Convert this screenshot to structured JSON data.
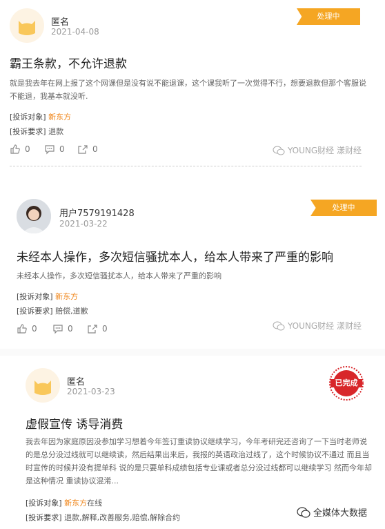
{
  "cards": [
    {
      "user": "匿名",
      "date": "2021-04-08",
      "status": "处理中",
      "title": "霸王条款，不允许退款",
      "body": "就是我去年在网上报了这个网课但是没有说不能退课，这个课我听了一次觉得不行，想要退款但那个客服说不能退，我基本就没听.",
      "target_label": "[投诉对象]",
      "target": "新东方",
      "target_suffix": "",
      "request_label": "[投诉要求]",
      "request": "退款",
      "likes": "0",
      "comments": "0",
      "shares": "0",
      "watermark": "YOUNG财经 漾财经"
    },
    {
      "user": "用户7579191428",
      "date": "2021-03-22",
      "status": "处理中",
      "title": "未经本人操作，多次短信骚扰本人，给本人带来了严重的影响",
      "body": "未经本人操作，多次短信骚扰本人，给本人带来了严重的影响",
      "target_label": "[投诉对象]",
      "target": "新东方",
      "target_suffix": "",
      "request_label": "[投诉要求]",
      "request": "赔偿,道歉",
      "likes": "0",
      "comments": "0",
      "shares": "0",
      "watermark": "YOUNG财经 漾财经"
    },
    {
      "user": "匿名",
      "date": "2021-03-23",
      "status": "已完成",
      "title": "虚假宣传 诱导消费",
      "body": "我去年因为家庭原因没参加学习想着今年签订重读协议继续学习，今年考研完还咨询了一下当时老师说的是总分没过线就可以继续读，然后结果出来后，我报的英语政治过线了，这个时候协议不通过 而且当时宣传的时候并没有提单科 说的是只要单科成绩包括专业课或者总分没过线都可以继续学习 然而今年却是这种情况 重读协议混淆...",
      "target_label": "[投诉对象]",
      "target": "新东方",
      "target_suffix": "在线",
      "request_label": "[投诉要求]",
      "request": "退款,解释,改善服务,赔偿,解除合约",
      "watermark": "全媒体大数据"
    }
  ],
  "colors": {
    "accent": "#f5a623",
    "org": "#f0861a",
    "seal": "#d8262a"
  },
  "icons": [
    "like-icon",
    "comment-icon",
    "share-icon",
    "wechat-icon",
    "cat-avatar-icon",
    "user-photo"
  ]
}
